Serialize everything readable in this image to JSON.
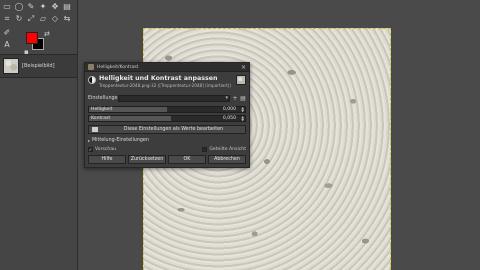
{
  "toolbox": {
    "fg_color": "#ff0000",
    "bg_color": "#000000",
    "tool_icons": [
      "rect-select-icon",
      "ellipse-select-icon",
      "free-select-icon",
      "fuzzy-select-icon",
      "move-icon",
      "align-icon",
      "crop-icon",
      "rotate-icon",
      "scale-icon",
      "shear-icon",
      "perspective-icon",
      "flip-icon",
      "paint-icon",
      "text-icon"
    ],
    "image_thumb_label": "[Beispielbild]"
  },
  "dialog": {
    "window_title": "Helligkeit/Kontrast",
    "heading": "Helligkeit und Kontrast anpassen",
    "subtitle": "Treppentextur-2048.png-32 ([Treppentextur-2048] (importiert))",
    "presets_label": "Einstellungen:",
    "presets_value": "",
    "brightness_label": "Helligkeit",
    "brightness_value": "0,000",
    "contrast_label": "Kontrast",
    "contrast_value": "0,050",
    "edit_as_values_label": "Diese Einstellungen als Werte bearbeiten",
    "blending_label": "Mittelung-Einstellungen",
    "preview_label": "Vorschau",
    "preview_checked": true,
    "split_view_label": "Geteilte Ansicht",
    "split_view_checked": false,
    "help_label": "Hilfe",
    "reset_label": "Zurücksetzen",
    "ok_label": "OK",
    "cancel_label": "Abbrechen"
  },
  "sliders": {
    "brightness_fraction": 0.5,
    "contrast_fraction": 0.525
  }
}
